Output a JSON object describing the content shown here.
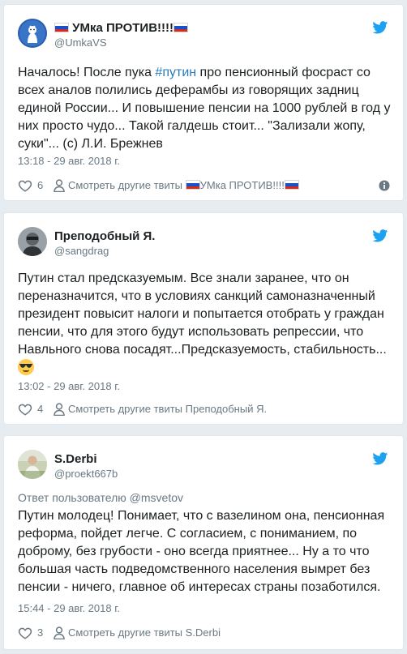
{
  "tweets": [
    {
      "name": "УМка ПРОТИВ!!!!",
      "handle": "@UmkaVS",
      "text_before": "Началось! После пука ",
      "hashtag": "#путин",
      "text_after": " про пенсионный фосраст со всех аналов полились деферамбы из говорящих задниц единой России... И повышение пенсии на 1000 рублей в год у них просто чудо... Такой галдешь стоит... \"Зализали жопу, суки\"... (с) Л.И. Брежнев",
      "timestamp": "13:18 - 29 авг. 2018 г.",
      "likes": "6",
      "more_label": "Смотреть другие твиты",
      "more_name": "УМка ПРОТИВ!!!!"
    },
    {
      "name": "Преподобный Я.",
      "handle": "@sangdrag",
      "text": "Путин стал предсказуемым. Все знали заранее, что он переназначится, что в условиях санкций самоназначенный президент повысит налоги и попытается отобрать у граждан пенсии, что для этого будут использовать репрессии, что Навльного снова посадят...Предсказуемость, стабильность...",
      "emoji": "smiling-face-with-sunglasses",
      "timestamp": "13:02 - 29 авг. 2018 г.",
      "likes": "4",
      "more_label": "Смотреть другие твиты Преподобный Я."
    },
    {
      "name": "S.Derbi",
      "handle": "@proekt667b",
      "reply_to": "Ответ пользователю @msvetov",
      "text": "Путин молодец! Понимает, что с вазелином она, пенсионная реформа, пойдет легче. С согласием, с пониманием, по доброму, без грубости - оно всегда приятнее... Ну а то что большая часть подведомственного населения вымрет без пенсии - ничего, главное об интересах страны позаботился.",
      "timestamp": "15:44 - 29 авг. 2018 г.",
      "likes": "3",
      "more_label": "Смотреть другие твиты S.Derbi"
    }
  ],
  "colors": {
    "background": "#e6ecf0",
    "card": "#ffffff",
    "text": "#1c2022",
    "muted": "#697882",
    "link": "#2b7bb9",
    "twitter_blue": "#1da1f2"
  },
  "icons": [
    "twitter-bird-icon",
    "heart-icon",
    "person-icon",
    "info-icon",
    "russian-flag-icon",
    "sunglasses-emoji-icon"
  ]
}
